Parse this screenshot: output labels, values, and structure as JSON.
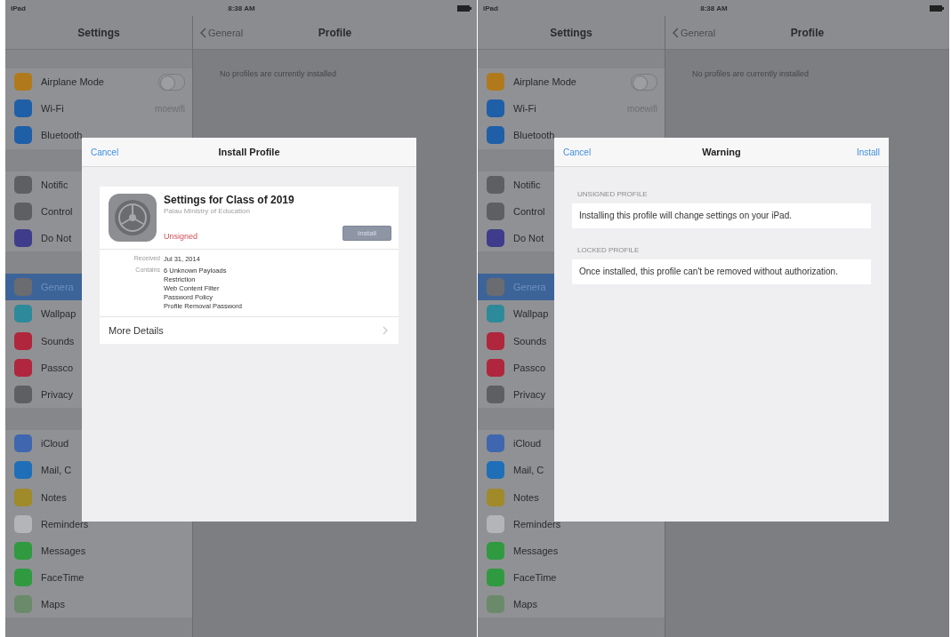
{
  "screens": [
    {
      "status_bar": {
        "carrier": "iPad",
        "time": "8:38 AM"
      },
      "sidebar": {
        "title": "Settings",
        "groups": [
          [
            {
              "kind": "toggle",
              "label": "Airplane Mode",
              "color": "#b07a1c",
              "on": false,
              "selected": false
            },
            {
              "kind": "value",
              "label": "Wi-Fi",
              "value": "moewifi",
              "color": "#1f5fa8",
              "selected": false
            },
            {
              "kind": "plain",
              "label": "Bluetooth",
              "color": "#1f5fa8",
              "selected": false
            }
          ],
          [
            {
              "kind": "plain",
              "label": "Notific",
              "color": "#5e5f62",
              "selected": false
            },
            {
              "kind": "plain",
              "label": "Control",
              "color": "#5e5f62",
              "selected": false
            },
            {
              "kind": "plain",
              "label": "Do Not",
              "color": "#3f3c8c",
              "selected": false
            }
          ],
          [
            {
              "kind": "plain",
              "label": "Genera",
              "color": "#6b6c70",
              "selected": true
            },
            {
              "kind": "plain",
              "label": "Wallpap",
              "color": "#2d8a9a",
              "selected": false
            },
            {
              "kind": "plain",
              "label": "Sounds",
              "color": "#b0263c",
              "selected": false
            },
            {
              "kind": "plain",
              "label": "Passco",
              "color": "#b0263c",
              "selected": false
            },
            {
              "kind": "plain",
              "label": "Privacy",
              "color": "#5e5f62",
              "selected": false
            }
          ],
          [
            {
              "kind": "plain",
              "label": "iCloud",
              "color": "#3f67b0",
              "selected": false
            },
            {
              "kind": "plain",
              "label": "Mail, C",
              "color": "#1f6fb8",
              "selected": false
            },
            {
              "kind": "plain",
              "label": "Notes",
              "color": "#a08a2a",
              "selected": false
            },
            {
              "kind": "plain",
              "label": "Reminders",
              "color": "#b4b5b8",
              "selected": false
            },
            {
              "kind": "plain",
              "label": "Messages",
              "color": "#2f9a40",
              "selected": false
            },
            {
              "kind": "plain",
              "label": "FaceTime",
              "color": "#2f9a40",
              "selected": false
            },
            {
              "kind": "plain",
              "label": "Maps",
              "color": "#6a8a6a",
              "selected": false
            }
          ]
        ]
      },
      "detail": {
        "back": "General",
        "title": "Profile",
        "message": "No profiles are currently installed"
      },
      "dialog": {
        "kind": "install_profile",
        "cancel": "Cancel",
        "title": "Install Profile",
        "profile": {
          "name": "Settings for Class of 2019",
          "org": "Palau Ministry of Education",
          "status": "Unsigned",
          "install": "Install",
          "disabled": true
        },
        "details": [
          {
            "label": "Received",
            "values": [
              "Jul 31, 2014"
            ]
          },
          {
            "label": "Contains",
            "values": [
              "6 Unknown Payloads",
              "Restriction",
              "Web Content Filter",
              "Password Policy",
              "Profile Removal Password"
            ]
          }
        ],
        "more": "More Details"
      }
    },
    {
      "status_bar": {
        "carrier": "iPad",
        "time": "8:38 AM"
      },
      "sidebar": {
        "title": "Settings",
        "groups": [
          [
            {
              "kind": "toggle",
              "label": "Airplane Mode",
              "color": "#b07a1c",
              "on": false,
              "selected": false
            },
            {
              "kind": "value",
              "label": "Wi-Fi",
              "value": "moewifi",
              "color": "#1f5fa8",
              "selected": false
            },
            {
              "kind": "plain",
              "label": "Bluetooth",
              "color": "#1f5fa8",
              "selected": false
            }
          ],
          [
            {
              "kind": "plain",
              "label": "Notific",
              "color": "#5e5f62",
              "selected": false
            },
            {
              "kind": "plain",
              "label": "Control",
              "color": "#5e5f62",
              "selected": false
            },
            {
              "kind": "plain",
              "label": "Do Not",
              "color": "#3f3c8c",
              "selected": false
            }
          ],
          [
            {
              "kind": "plain",
              "label": "Genera",
              "color": "#6b6c70",
              "selected": true
            },
            {
              "kind": "plain",
              "label": "Wallpap",
              "color": "#2d8a9a",
              "selected": false
            },
            {
              "kind": "plain",
              "label": "Sounds",
              "color": "#b0263c",
              "selected": false
            },
            {
              "kind": "plain",
              "label": "Passco",
              "color": "#b0263c",
              "selected": false
            },
            {
              "kind": "plain",
              "label": "Privacy",
              "color": "#5e5f62",
              "selected": false
            }
          ],
          [
            {
              "kind": "plain",
              "label": "iCloud",
              "color": "#3f67b0",
              "selected": false
            },
            {
              "kind": "plain",
              "label": "Mail, C",
              "color": "#1f6fb8",
              "selected": false
            },
            {
              "kind": "plain",
              "label": "Notes",
              "color": "#a08a2a",
              "selected": false
            },
            {
              "kind": "plain",
              "label": "Reminders",
              "color": "#b4b5b8",
              "selected": false
            },
            {
              "kind": "plain",
              "label": "Messages",
              "color": "#2f9a40",
              "selected": false
            },
            {
              "kind": "plain",
              "label": "FaceTime",
              "color": "#2f9a40",
              "selected": false
            },
            {
              "kind": "plain",
              "label": "Maps",
              "color": "#6a8a6a",
              "selected": false
            }
          ]
        ]
      },
      "detail": {
        "back": "General",
        "title": "Profile",
        "message": "No profiles are currently installed"
      },
      "dialog": {
        "kind": "warning",
        "cancel": "Cancel",
        "title": "Warning",
        "action": "Install",
        "sections": [
          {
            "heading": "UNSIGNED PROFILE",
            "text": "Installing this profile will change settings on your iPad."
          },
          {
            "heading": "LOCKED PROFILE",
            "text": "Once installed, this profile can't be removed without authorization."
          }
        ]
      }
    }
  ]
}
